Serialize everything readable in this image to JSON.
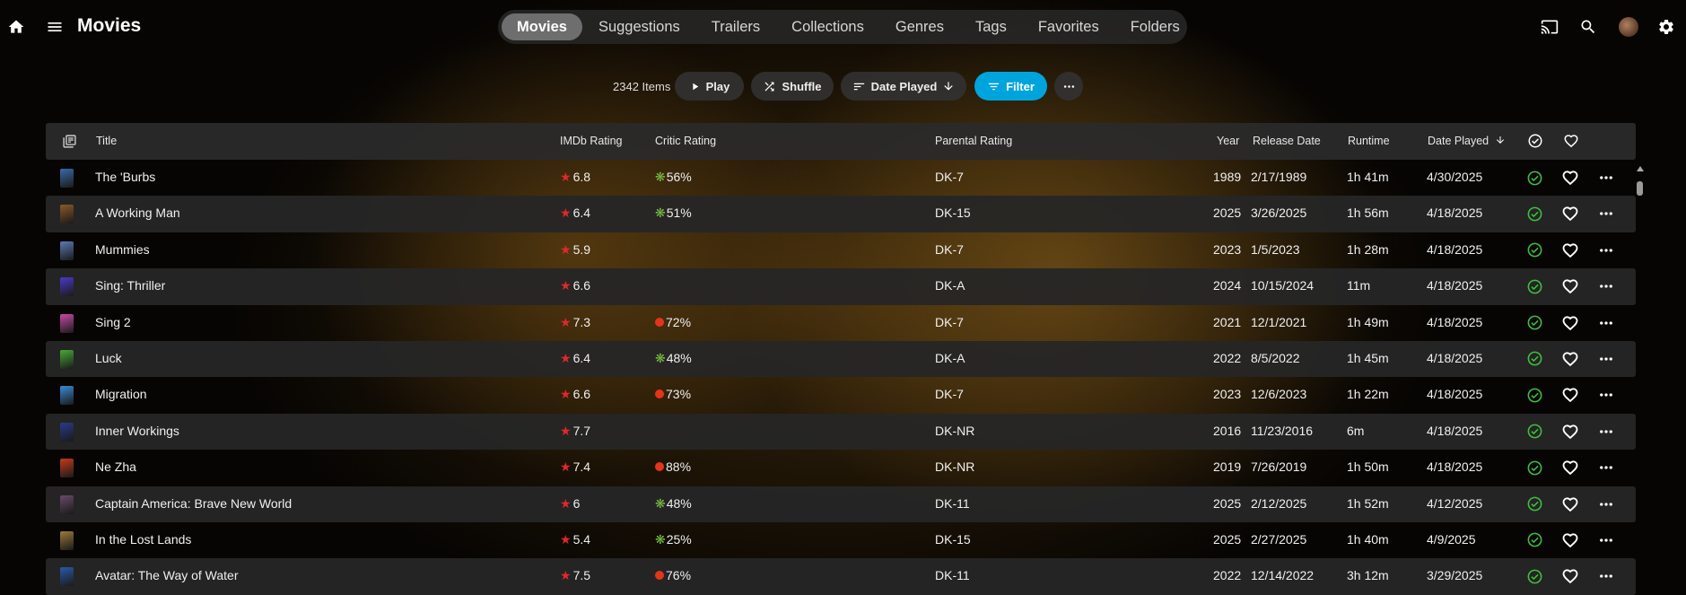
{
  "header": {
    "title": "Movies",
    "tabs": [
      "Movies",
      "Suggestions",
      "Trailers",
      "Collections",
      "Genres",
      "Tags",
      "Favorites",
      "Folders"
    ],
    "active_tab": "Movies"
  },
  "toolbar": {
    "count": "2342 Items",
    "play": "Play",
    "shuffle": "Shuffle",
    "sort": "Date Played",
    "filter": "Filter"
  },
  "table": {
    "columns": {
      "title": "Title",
      "imdb": "IMDb Rating",
      "critic": "Critic Rating",
      "parental": "Parental Rating",
      "year": "Year",
      "release": "Release Date",
      "runtime": "Runtime",
      "played": "Date Played"
    },
    "rows": [
      {
        "title": "The 'Burbs",
        "imdb": "6.8",
        "critic": "56%",
        "critic_type": "fresh",
        "parental": "DK-7",
        "year": "1989",
        "release": "2/17/1989",
        "runtime": "1h 41m",
        "played": "4/30/2025",
        "thumb": "#3a6aa8"
      },
      {
        "title": "A Working Man",
        "imdb": "6.4",
        "critic": "51%",
        "critic_type": "fresh",
        "parental": "DK-15",
        "year": "2025",
        "release": "3/26/2025",
        "runtime": "1h 56m",
        "played": "4/18/2025",
        "thumb": "#8a5a2a"
      },
      {
        "title": "Mummies",
        "imdb": "5.9",
        "critic": "",
        "critic_type": "",
        "parental": "DK-7",
        "year": "2023",
        "release": "1/5/2023",
        "runtime": "1h 28m",
        "played": "4/18/2025",
        "thumb": "#5a7ab8"
      },
      {
        "title": "Sing: Thriller",
        "imdb": "6.6",
        "critic": "",
        "critic_type": "",
        "parental": "DK-A",
        "year": "2024",
        "release": "10/15/2024",
        "runtime": "11m",
        "played": "4/18/2025",
        "thumb": "#4a3ac8"
      },
      {
        "title": "Sing 2",
        "imdb": "7.3",
        "critic": "72%",
        "critic_type": "rotten",
        "parental": "DK-7",
        "year": "2021",
        "release": "12/1/2021",
        "runtime": "1h 49m",
        "played": "4/18/2025",
        "thumb": "#c84aa8"
      },
      {
        "title": "Luck",
        "imdb": "6.4",
        "critic": "48%",
        "critic_type": "fresh",
        "parental": "DK-A",
        "year": "2022",
        "release": "8/5/2022",
        "runtime": "1h 45m",
        "played": "4/18/2025",
        "thumb": "#4aa838"
      },
      {
        "title": "Migration",
        "imdb": "6.6",
        "critic": "73%",
        "critic_type": "rotten",
        "parental": "DK-7",
        "year": "2023",
        "release": "12/6/2023",
        "runtime": "1h 22m",
        "played": "4/18/2025",
        "thumb": "#3a8ad8"
      },
      {
        "title": "Inner Workings",
        "imdb": "7.7",
        "critic": "",
        "critic_type": "",
        "parental": "DK-NR",
        "year": "2016",
        "release": "11/23/2016",
        "runtime": "6m",
        "played": "4/18/2025",
        "thumb": "#2a3a8a"
      },
      {
        "title": "Ne Zha",
        "imdb": "7.4",
        "critic": "88%",
        "critic_type": "rotten",
        "parental": "DK-NR",
        "year": "2019",
        "release": "7/26/2019",
        "runtime": "1h 50m",
        "played": "4/18/2025",
        "thumb": "#c8381a"
      },
      {
        "title": "Captain America: Brave New World",
        "imdb": "6",
        "critic": "48%",
        "critic_type": "fresh",
        "parental": "DK-11",
        "year": "2025",
        "release": "2/12/2025",
        "runtime": "1h 52m",
        "played": "4/12/2025",
        "thumb": "#6a4a6a"
      },
      {
        "title": "In the Lost Lands",
        "imdb": "5.4",
        "critic": "25%",
        "critic_type": "fresh",
        "parental": "DK-15",
        "year": "2025",
        "release": "2/27/2025",
        "runtime": "1h 40m",
        "played": "4/9/2025",
        "thumb": "#9a7a3a"
      },
      {
        "title": "Avatar: The Way of Water",
        "imdb": "7.5",
        "critic": "76%",
        "critic_type": "rotten",
        "parental": "DK-11",
        "year": "2022",
        "release": "12/14/2022",
        "runtime": "3h 12m",
        "played": "3/29/2025",
        "thumb": "#2a5aa8"
      }
    ]
  }
}
